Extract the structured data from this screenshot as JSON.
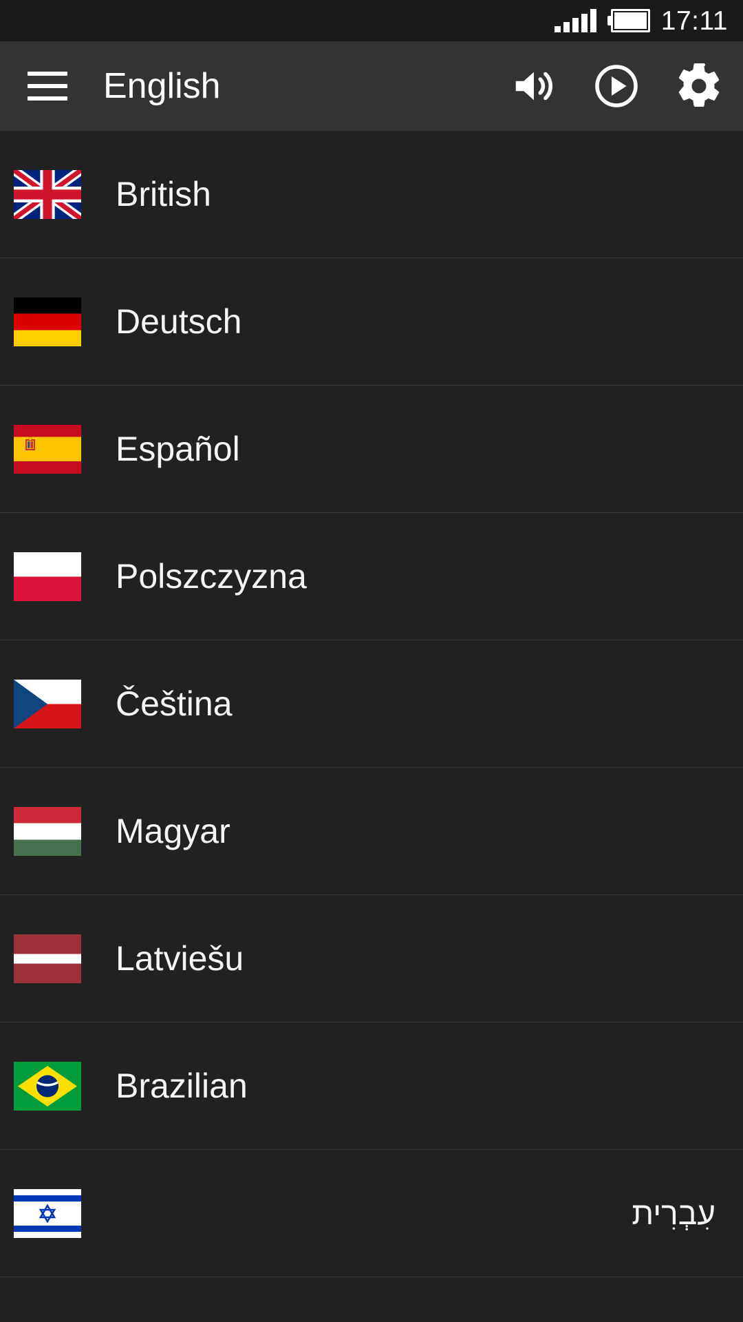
{
  "status_bar": {
    "time": "17:11",
    "signal_icon": "signal-bars-icon",
    "signal_bars": 5,
    "battery_icon": "battery-full-icon",
    "battery_level": "full"
  },
  "toolbar": {
    "menu_icon": "hamburger-menu-icon",
    "title": "English",
    "actions": [
      {
        "name": "volume-icon",
        "label": "Sound"
      },
      {
        "name": "play-icon",
        "label": "Play"
      },
      {
        "name": "settings-gear-icon",
        "label": "Settings"
      }
    ]
  },
  "language_list": {
    "items": [
      {
        "label": "British",
        "flag": "uk-flag-icon",
        "dir": "ltr"
      },
      {
        "label": "Deutsch",
        "flag": "germany-flag-icon",
        "dir": "ltr"
      },
      {
        "label": "Español",
        "flag": "spain-flag-icon",
        "dir": "ltr"
      },
      {
        "label": "Polszczyzna",
        "flag": "poland-flag-icon",
        "dir": "ltr"
      },
      {
        "label": "Čeština",
        "flag": "czech-flag-icon",
        "dir": "ltr"
      },
      {
        "label": "Magyar",
        "flag": "hungary-flag-icon",
        "dir": "ltr"
      },
      {
        "label": "Latviešu",
        "flag": "latvia-flag-icon",
        "dir": "ltr"
      },
      {
        "label": "Brazilian",
        "flag": "brazil-flag-icon",
        "dir": "ltr"
      },
      {
        "label": "עִבְרִית",
        "flag": "israel-flag-icon",
        "dir": "rtl"
      }
    ]
  },
  "colors": {
    "status_bar_bg": "#1a1a1a",
    "toolbar_bg": "#333333",
    "list_bg": "#212121",
    "divider": "#3a3a3a",
    "text": "#f5f5f5"
  }
}
